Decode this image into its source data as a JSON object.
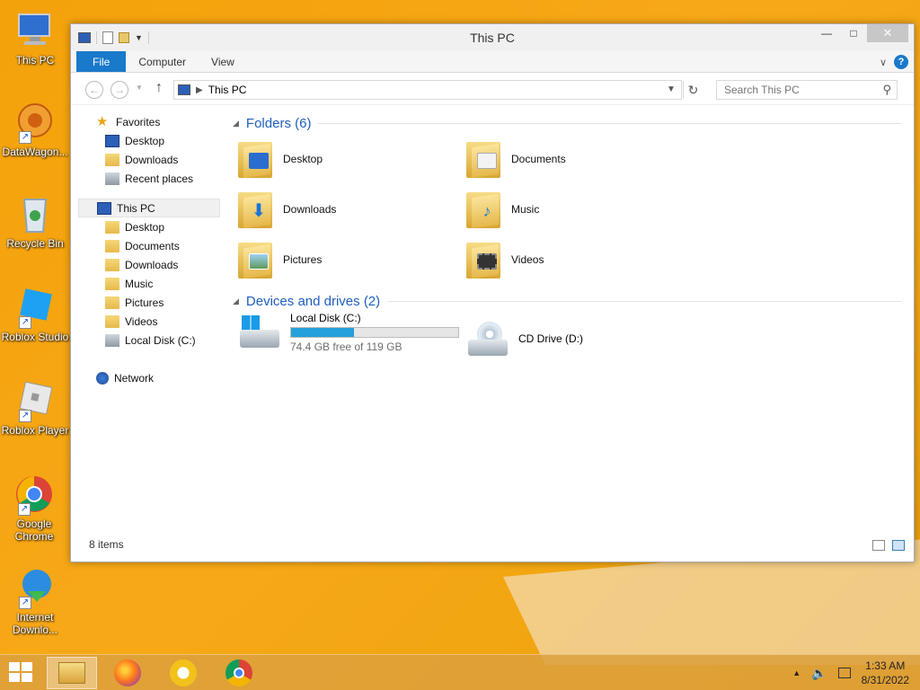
{
  "desktop": {
    "icons": [
      {
        "label": "This PC"
      },
      {
        "label": "DataWagon..."
      },
      {
        "label": "Recycle Bin"
      },
      {
        "label": "Roblox Studio"
      },
      {
        "label": "Roblox Player"
      },
      {
        "label": "Google Chrome"
      },
      {
        "label": "Internet Downlo..."
      }
    ]
  },
  "window": {
    "title": "This PC",
    "ribbon": {
      "tabs": [
        "File",
        "Computer",
        "View"
      ],
      "help_label": "?"
    },
    "address": {
      "path": "This PC"
    },
    "search": {
      "placeholder": "Search This PC"
    },
    "navpane": {
      "favorites_label": "Favorites",
      "favorites": [
        "Desktop",
        "Downloads",
        "Recent places"
      ],
      "thispc_label": "This PC",
      "thispc_items": [
        "Desktop",
        "Documents",
        "Downloads",
        "Music",
        "Pictures",
        "Videos",
        "Local Disk (C:)"
      ],
      "network_label": "Network"
    },
    "content": {
      "folders_header": "Folders (6)",
      "folders": [
        "Desktop",
        "Documents",
        "Downloads",
        "Music",
        "Pictures",
        "Videos"
      ],
      "devices_header": "Devices and drives (2)",
      "drives": [
        {
          "name": "Local Disk (C:)",
          "free_text": "74.4 GB free of 119 GB",
          "used_fraction": 0.375
        },
        {
          "name": "CD Drive (D:)"
        }
      ]
    },
    "status": "8 items"
  },
  "taskbar": {
    "time": "1:33 AM",
    "date": "8/31/2022"
  },
  "colors": {
    "accent": "#1979ca",
    "progress": "#26a0da",
    "header_text": "#1e5ebd",
    "wallpaper": "#f4a20b"
  }
}
